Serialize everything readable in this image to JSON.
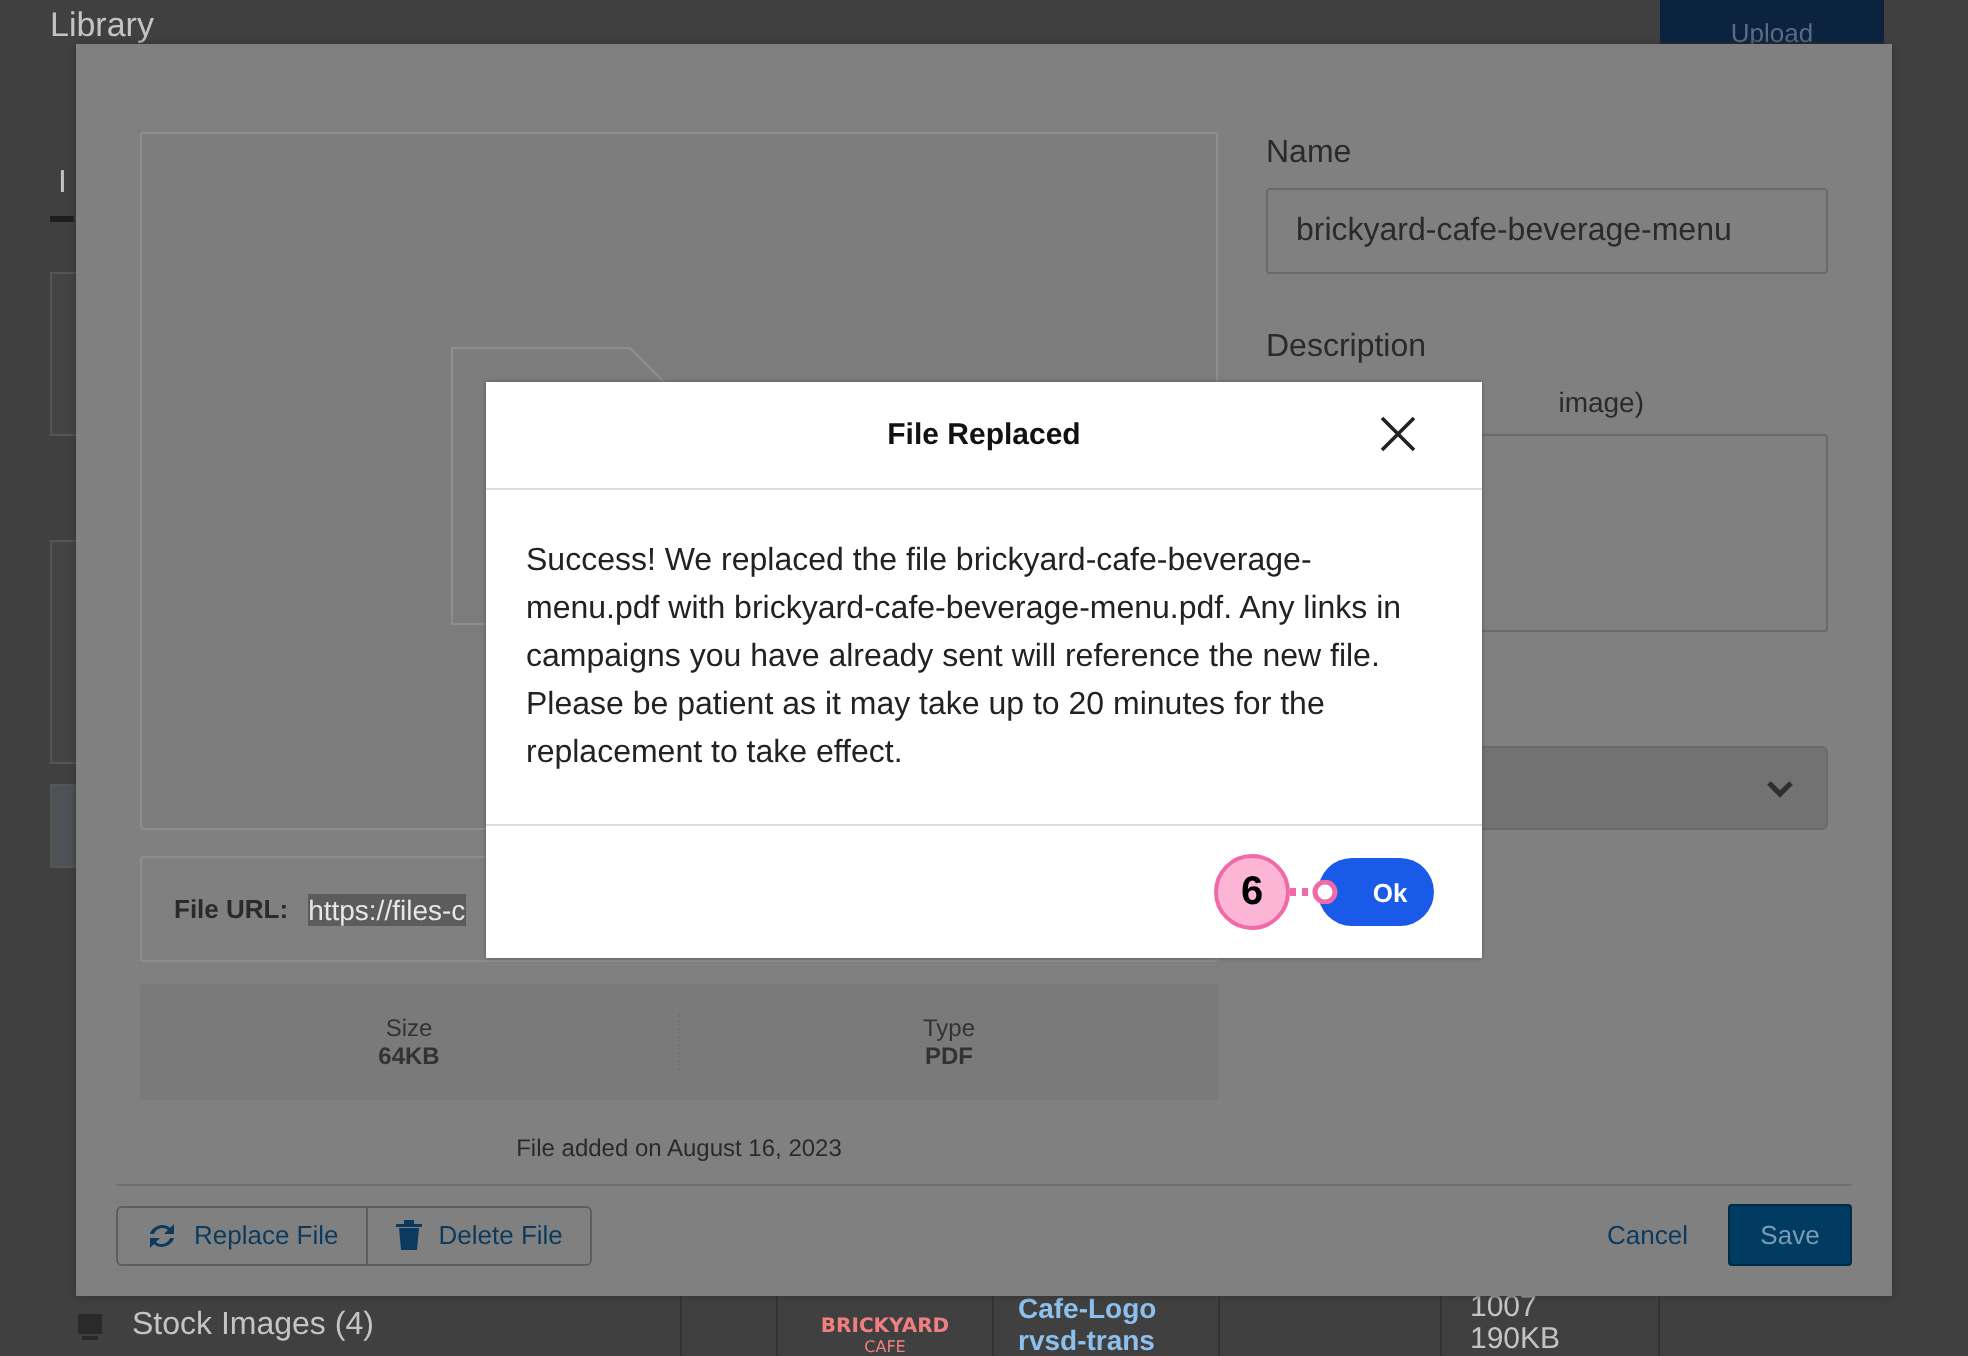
{
  "page": {
    "title": "Library",
    "upload_button": "Upload",
    "tab": "I",
    "sidebar_item": "Stock Images (4)",
    "table_row": {
      "logo_text": "BRICKYARD",
      "logo_subtext": "CAFE",
      "name_lines": [
        "Cafe-Logo",
        "rvsd-trans"
      ],
      "dimensions": "1007",
      "size": "190KB"
    }
  },
  "file_dialog": {
    "file_url_label": "File URL:",
    "file_url": "https://files-c",
    "details": [
      {
        "label": "Size",
        "value": "64KB"
      },
      {
        "label": "Type",
        "value": "PDF"
      }
    ],
    "added": "File added on August 16, 2023",
    "actions": [
      {
        "kind": "replace",
        "label": "Replace File"
      },
      {
        "kind": "delete",
        "label": "Delete File"
      }
    ],
    "name_label": "Name",
    "name_value": "brickyard-cafe-beverage-menu",
    "description_label": "Description",
    "description_hint": "image)",
    "cancel": "Cancel",
    "save": "Save"
  },
  "alert": {
    "title": "File Replaced",
    "message": "Success! We replaced the file brickyard-cafe-beverage-menu.pdf with brickyard-cafe-beverage-menu.pdf. Any links in campaigns you have already sent will reference the new file. Please be patient as it may take up to 20 minutes for the replacement to take effect.",
    "ok": "Ok"
  },
  "annotation": {
    "number": "6"
  }
}
